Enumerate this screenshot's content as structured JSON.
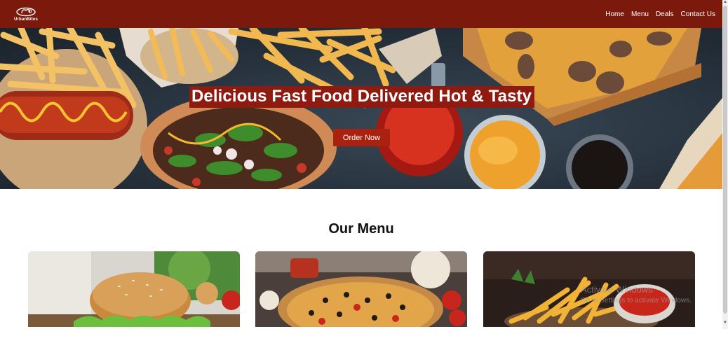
{
  "nav": {
    "logo_text": "UrbanBites",
    "logo_icon": "chef-hat-logo-icon",
    "links": [
      "Home",
      "Menu",
      "Deals",
      "Contact Us"
    ]
  },
  "hero": {
    "title": "Delicious Fast Food Delivered Hot & Tasty",
    "cta_label": "Order Now"
  },
  "menu": {
    "title": "Our Menu",
    "cards": [
      {
        "item": "burger"
      },
      {
        "item": "pizza"
      },
      {
        "item": "fries"
      }
    ]
  },
  "watermark": {
    "line1": "Activate Windows",
    "line2": "Go to Settings to activate Windows."
  },
  "colors": {
    "navbar": "#7b1a0c",
    "title_bg": "#8e1a10",
    "cta_bg": "#a8220f"
  }
}
